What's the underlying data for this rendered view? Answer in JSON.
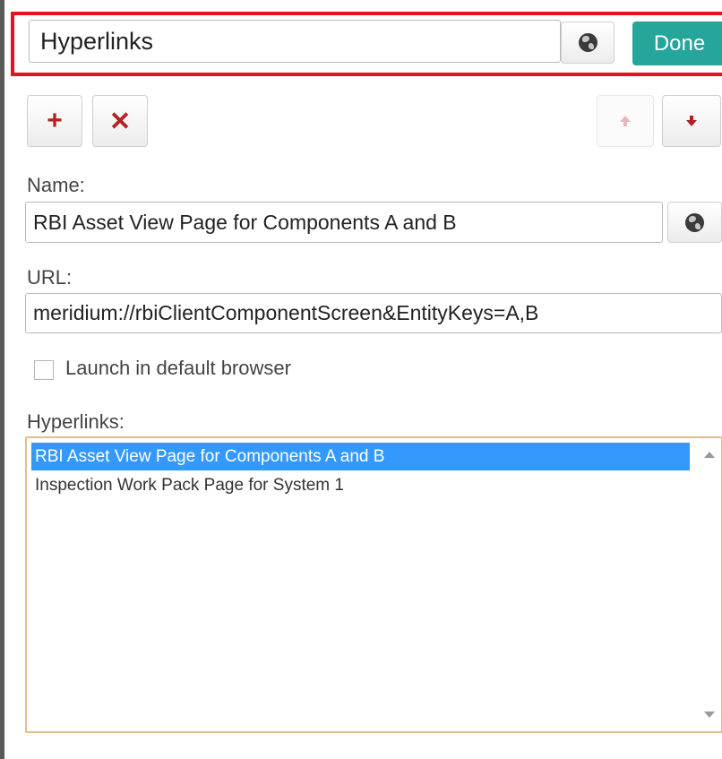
{
  "header": {
    "title_value": "Hyperlinks",
    "done_label": "Done",
    "globe_icon": "globe-icon"
  },
  "toolbar": {
    "add_glyph": "+",
    "remove_glyph": "✕",
    "up_icon": "arrow-up-icon",
    "down_icon": "arrow-down-icon"
  },
  "form": {
    "name_label": "Name:",
    "name_value": "RBI Asset View Page for Components A and B",
    "url_label": "URL:",
    "url_value": "meridium://rbiClientComponentScreen&EntityKeys=A,B",
    "launch_label": "Launch in default browser",
    "launch_checked": false,
    "hyperlinks_label": "Hyperlinks:"
  },
  "hyperlinks": {
    "items": [
      {
        "label": "RBI Asset View Page for Components A and B",
        "selected": true
      },
      {
        "label": "Inspection Work Pack Page for System 1",
        "selected": false
      }
    ]
  },
  "colors": {
    "accent": "#26a59a",
    "highlight_border": "#e8121c",
    "selection": "#3399ff",
    "icon_red": "#b22222"
  }
}
